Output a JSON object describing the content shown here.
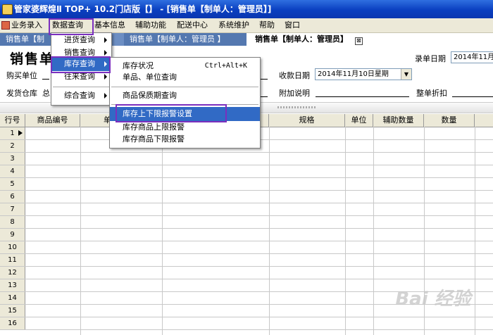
{
  "window": {
    "title": "管家婆辉煌Ⅱ TOP+ 10.2门店版【】 - [销售单【制单人：管理员】]"
  },
  "menubar": {
    "items": [
      "业务录入",
      "数据查询",
      "基本信息",
      "辅助功能",
      "配送中心",
      "系统维护",
      "帮助",
      "窗口"
    ],
    "active": "数据查询"
  },
  "tabs": {
    "items": [
      "销售单【制",
      "销售单【制单人：管理员 】",
      "销售单【制单人：管理员】"
    ],
    "close_glyph": "⊠"
  },
  "form": {
    "title": "销售单",
    "labels": {
      "buyer": "购买单位",
      "warehouse": "发货仓库",
      "warehouse_suffix": "总",
      "receipt_date": "收款日期",
      "attached": "附加说明",
      "discount": "整单折扣",
      "entry_date": "录单日期"
    },
    "values": {
      "receipt_date": "2014年11月10日星期",
      "entry_date": "2014年11月"
    }
  },
  "grid": {
    "columns": [
      "行号",
      "商品编号",
      "单",
      "规格",
      "单位",
      "辅助数量",
      "数量"
    ],
    "rows": [
      "1",
      "2",
      "3",
      "4",
      "5",
      "6",
      "7",
      "8",
      "9",
      "10",
      "11",
      "12",
      "13",
      "14",
      "15",
      "16"
    ],
    "selected_row": "1"
  },
  "menus": {
    "data_query": {
      "items": [
        "进货查询",
        "销售查询",
        "库存查询",
        "往来查询",
        "综合查询"
      ],
      "selected": "库存查询"
    },
    "stock_query": {
      "items": [
        {
          "label": "库存状况",
          "shortcut": "Ctrl+Alt+K"
        },
        {
          "label": "单品、单位查询"
        },
        {
          "label": "商品保质期查询"
        },
        {
          "label": "库存上下限报警设置"
        },
        {
          "label": "库存商品上限报警"
        },
        {
          "label": "库存商品下限报警"
        }
      ],
      "selected": "库存上下限报警设置"
    }
  },
  "colors": {
    "highlight_box": "#7b2fbe",
    "menu_selection": "#316ac5",
    "titlebar": "#0a3fc0"
  },
  "watermark": "Bai 经验"
}
